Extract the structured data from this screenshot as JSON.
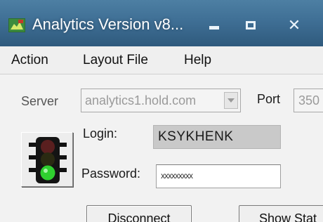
{
  "window": {
    "title": "Analytics Version v8...",
    "icon": "app-logo-icon",
    "controls": {
      "minimize": "minimize-icon",
      "maximize": "maximize-icon",
      "close": "close-icon"
    }
  },
  "menu": {
    "action": "Action",
    "layout_file": "Layout File",
    "help": "Help"
  },
  "form": {
    "server_label": "Server",
    "server_value": "analytics1.hold.com",
    "port_label": "Port",
    "port_value": "350",
    "login_label": "Login:",
    "login_value": "KSYKHENK",
    "password_label": "Password:",
    "password_value": "xxxxxxxxx",
    "connect_icon": "traffic-light-icon"
  },
  "buttons": {
    "disconnect": "Disconnect",
    "show_status": "Show Stat"
  },
  "colors": {
    "titlebar": "#3f6f95",
    "traffic_light_green": "#2fd02f",
    "traffic_light_off": "#5a1f1f"
  }
}
